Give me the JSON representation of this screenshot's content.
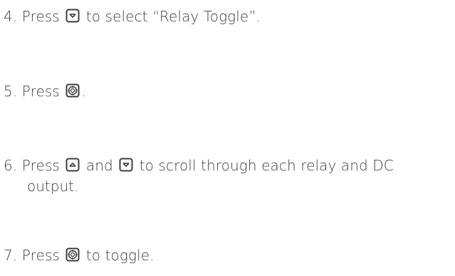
{
  "steps": [
    {
      "number": "4.",
      "before": "Press",
      "key": "down-arrow-key-icon",
      "after": "to select “Relay Toggle”."
    },
    {
      "number": "5.",
      "before": "Press",
      "key": "select-key-icon",
      "after": "."
    },
    {
      "number": "6.",
      "before": "Press",
      "key1": "up-arrow-key-icon",
      "middle": "and",
      "key2": "down-arrow-key-icon",
      "after": "to scroll through each relay and DC",
      "continuation": "output."
    },
    {
      "number": "7.",
      "before": "Press",
      "key": "select-key-icon",
      "after": "to toggle."
    }
  ],
  "colors": {
    "text": "#3c3c3c",
    "icon_stroke": "#3c3c3c"
  }
}
